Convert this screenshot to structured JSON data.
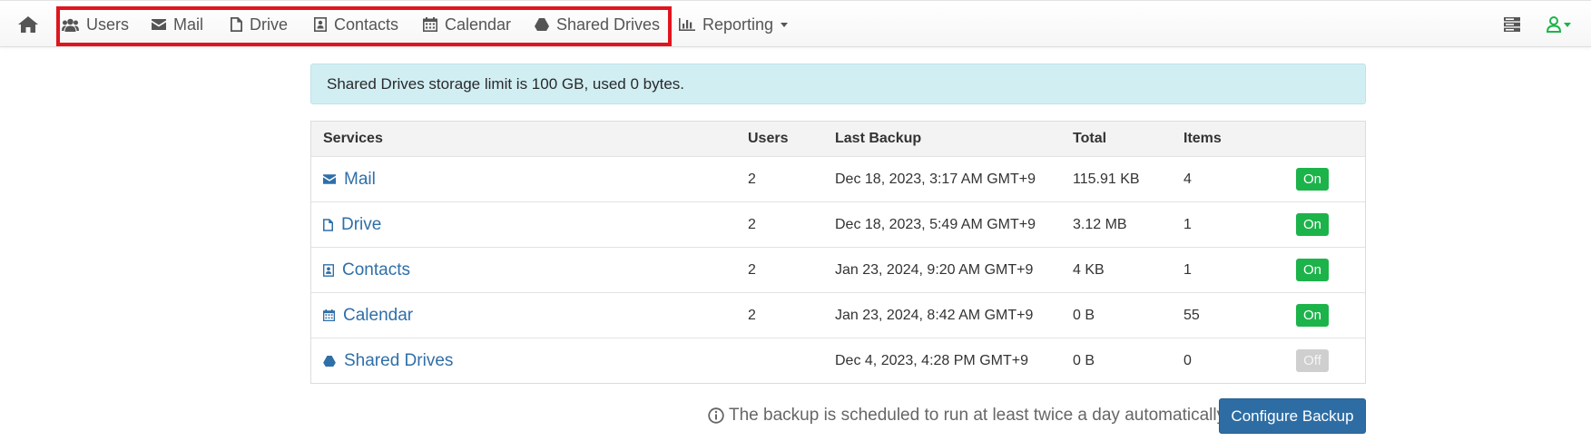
{
  "nav": {
    "items": [
      {
        "label": "Users",
        "icon": "users-icon"
      },
      {
        "label": "Mail",
        "icon": "envelope-icon"
      },
      {
        "label": "Drive",
        "icon": "file-icon"
      },
      {
        "label": "Contacts",
        "icon": "contact-card-icon"
      },
      {
        "label": "Calendar",
        "icon": "calendar-icon"
      },
      {
        "label": "Shared Drives",
        "icon": "drive-triangle-icon"
      }
    ],
    "reporting": {
      "label": "Reporting",
      "icon": "bar-chart-icon"
    },
    "highlight_color": "#e0141e"
  },
  "alert": {
    "text": "Shared Drives storage limit is 100 GB, used 0 bytes."
  },
  "table": {
    "headers": {
      "services": "Services",
      "users": "Users",
      "last_backup": "Last Backup",
      "total": "Total",
      "items": "Items"
    },
    "rows": [
      {
        "service": "Mail",
        "users": "2",
        "last_backup": "Dec 18, 2023, 3:17 AM GMT+9",
        "total": "115.91 KB",
        "items": "4",
        "status": "On"
      },
      {
        "service": "Drive",
        "users": "2",
        "last_backup": "Dec 18, 2023, 5:49 AM GMT+9",
        "total": "3.12 MB",
        "items": "1",
        "status": "On"
      },
      {
        "service": "Contacts",
        "users": "2",
        "last_backup": "Jan 23, 2024, 9:20 AM GMT+9",
        "total": "4 KB",
        "items": "1",
        "status": "On"
      },
      {
        "service": "Calendar",
        "users": "2",
        "last_backup": "Jan 23, 2024, 8:42 AM GMT+9",
        "total": "0 B",
        "items": "55",
        "status": "On"
      },
      {
        "service": "Shared Drives",
        "users": "",
        "last_backup": "Dec 4, 2023, 4:28 PM GMT+9",
        "total": "0 B",
        "items": "0",
        "status": "Off"
      }
    ]
  },
  "footer": {
    "note": "The backup is scheduled to run at least twice a day automatically",
    "configure_label": "Configure Backup"
  },
  "colors": {
    "status_on": "#1db34b",
    "status_off": "#cfcfcf",
    "link": "#2f6fa8",
    "primary_button": "#2e6da4",
    "alert_bg": "#d1eef3"
  }
}
